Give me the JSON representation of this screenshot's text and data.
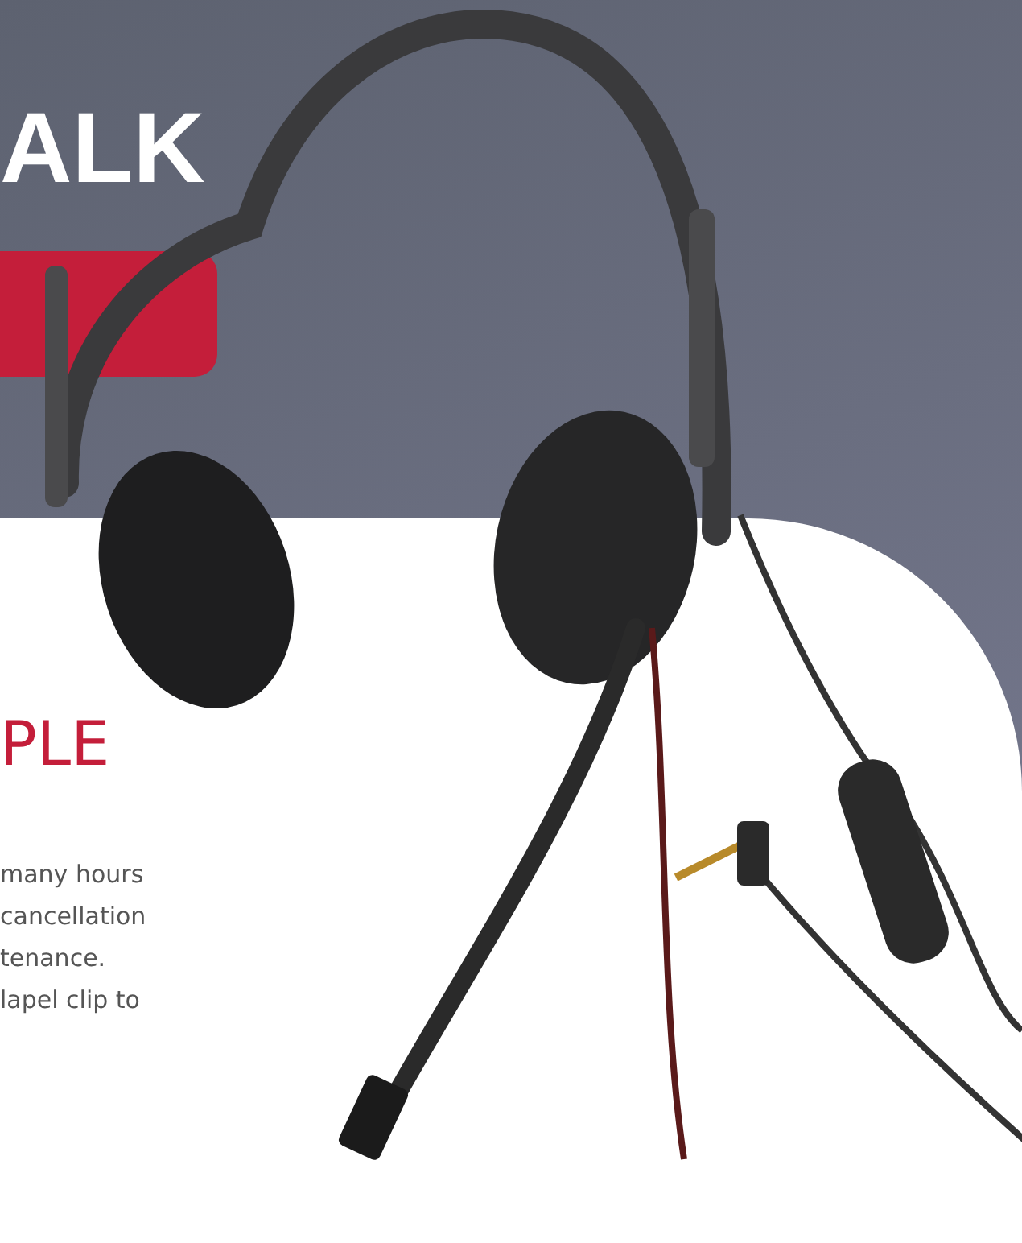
{
  "hero": {
    "heading": "ALK"
  },
  "section": {
    "heading": "PLE",
    "paragraph_lines": [
      "many hours",
      "cancellation",
      "tenance.",
      "lapel clip to"
    ]
  }
}
